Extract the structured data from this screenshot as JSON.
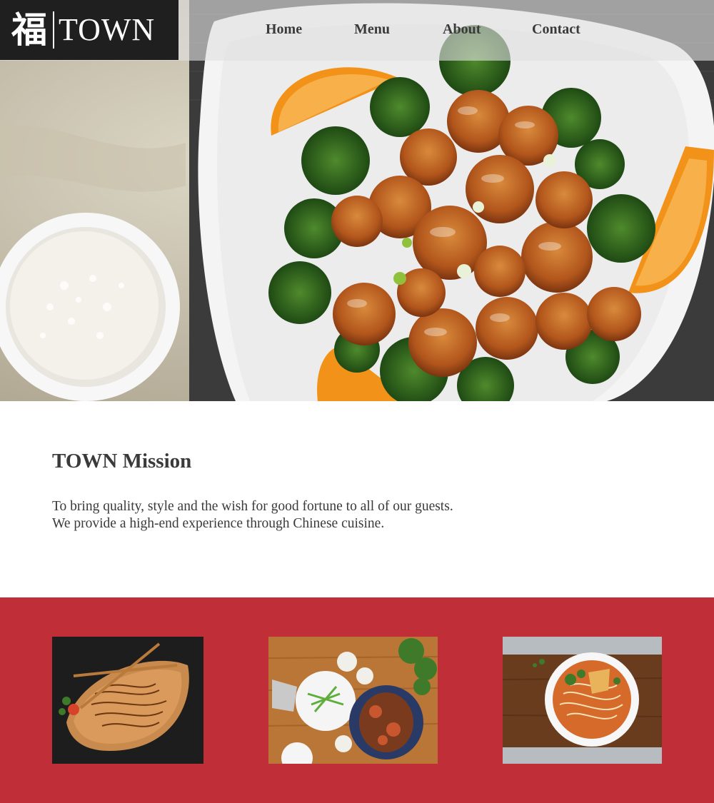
{
  "brand": {
    "logo_char": "福",
    "logo_text": "TOWN"
  },
  "nav": {
    "items": [
      "Home",
      "Menu",
      "About",
      "Contact"
    ]
  },
  "mission": {
    "title": "TOWN Mission",
    "line1": "To bring quality, style and the wish for good fortune to all of our guests.",
    "line2": "We provide a high-end experience through Chinese cuisine."
  },
  "colors": {
    "band": "#c02f37",
    "logo_bg": "#1f1f1f",
    "text": "#3a3a3a"
  },
  "gallery": [
    {
      "icon": "noodles-photo"
    },
    {
      "icon": "table-spread-photo"
    },
    {
      "icon": "noodle-soup-photo"
    }
  ]
}
